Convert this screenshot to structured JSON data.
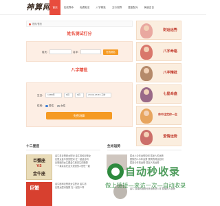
{
  "header": {
    "logo": "神算网",
    "nav": [
      "首页",
      "在线算命",
      "免费取名",
      "八字精批",
      "五行测算",
      "星座配对",
      "黄道吉日"
    ],
    "active_index": 0
  },
  "breadcrumb": "首页/首页",
  "name_test": {
    "title": "姓名测试打分",
    "surname_label": "姓氏:",
    "surname_placeholder": "",
    "given_label": "名字:",
    "given_placeholder": "",
    "submit": "在线测名"
  },
  "bazi": {
    "title": "八字精批",
    "birth_label": "生日:",
    "year": "1988年",
    "month": "6月",
    "day": "6日",
    "hour": "23:00-23:59 子时",
    "gender_label": "性别:",
    "male": "男性",
    "female": "女性",
    "selected_gender": "male",
    "submit": "免费测算"
  },
  "sidebar_cards": [
    "财运运势",
    "八字命格",
    "八字精批",
    "七星命盘",
    "命中注定你一生",
    "爱情运势"
  ],
  "bottom_left": {
    "title": "十二星座",
    "zodiac_box": {
      "line1": "巨蟹座",
      "vs": "VS",
      "line2": "金牛座"
    },
    "zodiac_box2": "巨蟹",
    "paragraphs": [
      "金牛男巨蟹座女配对 金牛男和巨蟹女",
      "巨蟹女金牛男的配对 在一起适合吗",
      "巨蟹座的女生跟金牛座男生的搭配",
      "一个真实实在且又浪漫的人配在一起",
      "金牛座和巨蟹座女生配对 金牛男",
      "巨蟹女配对指数 在一起怎么样"
    ]
  },
  "bottom_right": {
    "title": "生肖运势",
    "paragraphs": [
      "属龙人今年运势如何 属龙人的运势",
      "属狗的人今年运势 属狗的财运如何",
      "属鼠今年的运势 属鼠人的运势",
      "金牛 属兔的运势分析运势怎么样 属兔的人运势"
    ]
  },
  "watermark": {
    "title": "自动秒收录",
    "subtitle": "做上链接—来访一次—自动收录"
  }
}
